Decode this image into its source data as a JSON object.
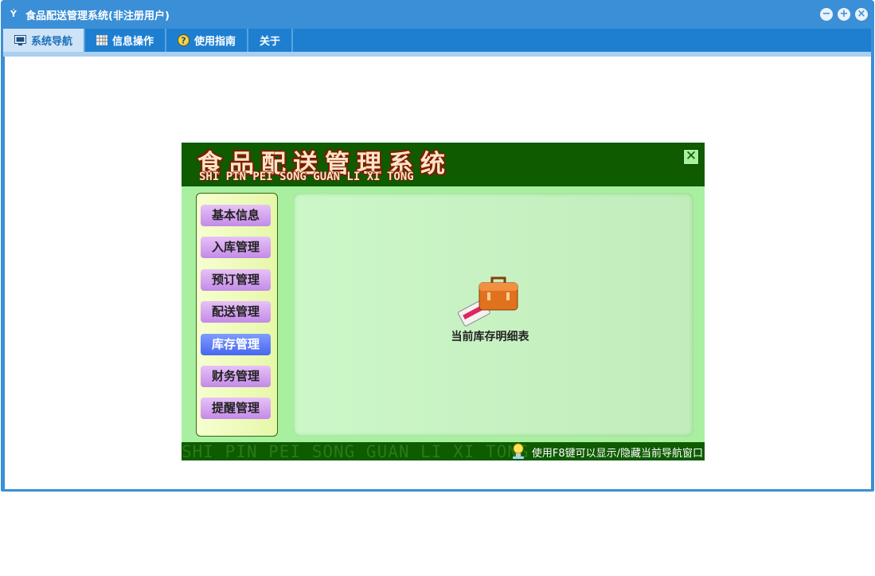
{
  "window": {
    "title": "食品配送管理系统(非注册用户)",
    "app_icon": "Ý",
    "controls": {
      "minimize": "−",
      "restore": "+",
      "close": "×"
    }
  },
  "tabs": [
    {
      "label": "系统导航",
      "icon": "monitor-icon",
      "active": true
    },
    {
      "label": "信息操作",
      "icon": "grid-icon",
      "active": false
    },
    {
      "label": "使用指南",
      "icon": "help-icon",
      "active": false
    },
    {
      "label": "关于",
      "icon": "",
      "active": false
    }
  ],
  "nav_panel": {
    "title": "食品配送管理系统",
    "subtitle": "SHI PIN PEI SONG GUAN LI XI TONG",
    "close_glyph": "✕",
    "menu": [
      {
        "label": "基本信息",
        "selected": false
      },
      {
        "label": "入库管理",
        "selected": false
      },
      {
        "label": "预订管理",
        "selected": false
      },
      {
        "label": "配送管理",
        "selected": false
      },
      {
        "label": "库存管理",
        "selected": true
      },
      {
        "label": "财务管理",
        "selected": false
      },
      {
        "label": "提醒管理",
        "selected": false
      }
    ],
    "item": {
      "label": "当前库存明细表",
      "icon": "briefcase-icon"
    },
    "footer_watermark": "SHI PIN PEI SONG GUAN LI XI TONG",
    "footer_hint": "使用F8键可以显示/隐藏当前导航窗口"
  },
  "colors": {
    "titlebar": "#3a8fd6",
    "tabbar": "#1e7fd1",
    "nav_green": "#0e5b00",
    "menu_button": "#c48ae8",
    "menu_button_selected": "#4766ee"
  }
}
